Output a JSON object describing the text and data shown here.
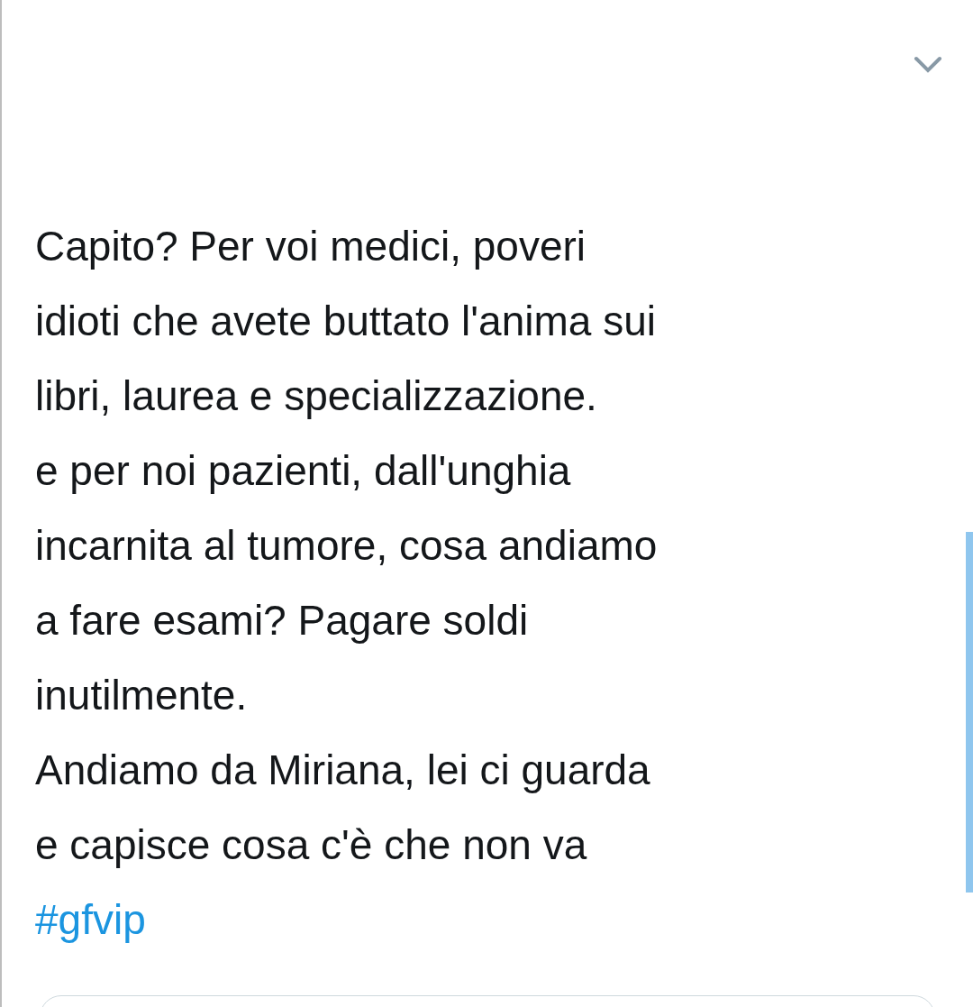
{
  "tweet": {
    "lines": [
      "Capito? Per voi medici, poveri",
      "idioti che avete buttato l'anima sui",
      "libri, laurea e specializzazione.",
      "e per noi pazienti, dall'unghia",
      "incarnita al tumore, cosa andiamo",
      "a fare esami? Pagare soldi",
      "inutilmente.",
      "Andiamo da Miriana, lei ci guarda",
      "e capisce cosa c'è che non va"
    ],
    "hashtag": "#gfvip"
  }
}
